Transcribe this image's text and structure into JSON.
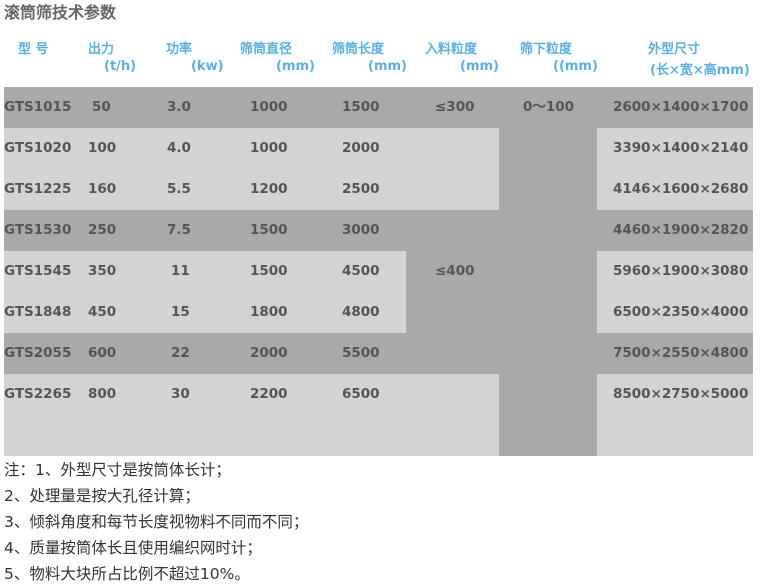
{
  "title": "滚筒筛技术参数",
  "headers": [
    {
      "line1": "型 号",
      "line2": ""
    },
    {
      "line1": "出力",
      "line2": "(t/h)"
    },
    {
      "line1": "功率",
      "line2": "(kw)"
    },
    {
      "line1": "筛筒直径",
      "line2": "(mm)"
    },
    {
      "line1": "筛筒长度",
      "line2": "(mm)"
    },
    {
      "line1": "入料粒度",
      "line2": "(mm)"
    },
    {
      "line1": "筛下粒度",
      "line2": "((mm)"
    },
    {
      "line1": "外型尺寸",
      "line2": "(长×宽×高mm)"
    }
  ],
  "rows": [
    {
      "model": "GTS1015",
      "output": "50",
      "power": "3.0",
      "diameter": "1000",
      "length": "1500",
      "size": "2600×1400×1700"
    },
    {
      "model": "GTS1020",
      "output": "100",
      "power": "4.0",
      "diameter": "1000",
      "length": "2000",
      "size": "3390×1400×2140"
    },
    {
      "model": "GTS1225",
      "output": "160",
      "power": "5.5",
      "diameter": "1200",
      "length": "2500",
      "size": "4146×1600×2680"
    },
    {
      "model": "GTS1530",
      "output": "250",
      "power": "7.5",
      "diameter": "1500",
      "length": "3000",
      "size": "4460×1900×2820"
    },
    {
      "model": "GTS1545",
      "output": "350",
      "power": "11",
      "diameter": "1500",
      "length": "4500",
      "size": "5960×1900×3080"
    },
    {
      "model": "GTS1848",
      "output": "450",
      "power": "15",
      "diameter": "1800",
      "length": "4800",
      "size": "6500×2350×4000"
    },
    {
      "model": "GTS2055",
      "output": "600",
      "power": "22",
      "diameter": "2000",
      "length": "5500",
      "size": "7500×2550×4800"
    },
    {
      "model": "GTS2265",
      "output": "800",
      "power": "30",
      "diameter": "2200",
      "length": "6500",
      "size": "8500×2750×5000"
    }
  ],
  "feed_size": {
    "group1": "≤300",
    "group2": "≤400"
  },
  "undersize": "0～100",
  "notes": [
    "注：1、外型尺寸是按筒体长计；",
    "2、处理量是按大孔径计算；",
    "3、倾斜角度和每节长度视物料不同而不同；",
    "4、质量按筒体长且使用编织网时计；",
    "5、物料大块所占比例不超过10%。"
  ]
}
